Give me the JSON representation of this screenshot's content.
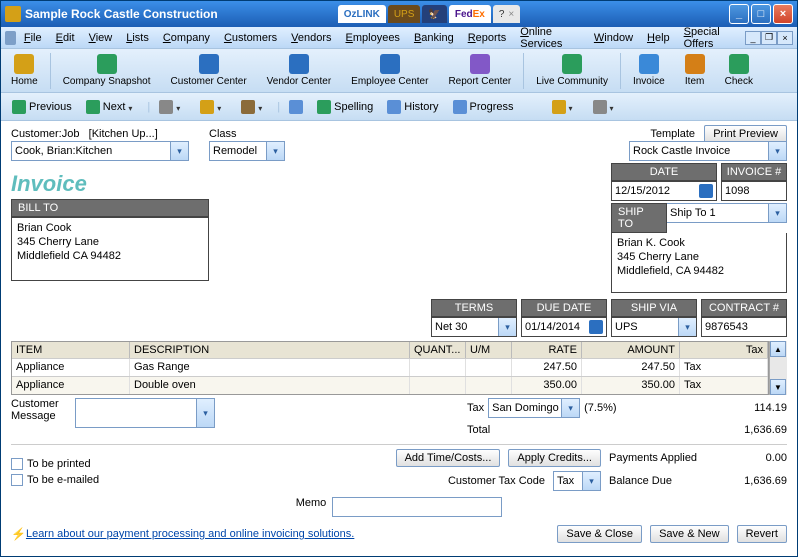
{
  "titlebar": {
    "title": "Sample Rock Castle Construction",
    "tabs": [
      "OzLINK",
      "UPS",
      "USPS",
      "FedEx",
      "?"
    ]
  },
  "menubar": [
    "File",
    "Edit",
    "View",
    "Lists",
    "Company",
    "Customers",
    "Vendors",
    "Employees",
    "Banking",
    "Reports",
    "Online Services",
    "Window",
    "Help",
    "Special Offers"
  ],
  "toolbar": [
    {
      "label": "Home",
      "color": "#d4a017"
    },
    {
      "label": "Company Snapshot",
      "color": "#2b9d5c"
    },
    {
      "label": "Customer Center",
      "color": "#2b6fc0"
    },
    {
      "label": "Vendor Center",
      "color": "#2b6fc0"
    },
    {
      "label": "Employee Center",
      "color": "#2b6fc0"
    },
    {
      "label": "Report Center",
      "color": "#8258c7"
    },
    {
      "label": "Live Community",
      "color": "#2b9d5c"
    },
    {
      "label": "Invoice",
      "color": "#3a89d8"
    },
    {
      "label": "Item",
      "color": "#d47f17"
    },
    {
      "label": "Check",
      "color": "#2b9d5c"
    }
  ],
  "navbar": {
    "prev": "Previous",
    "next": "Next",
    "spelling": "Spelling",
    "history": "History",
    "progress": "Progress"
  },
  "form": {
    "customer_label": "Customer:Job",
    "kitchen_hint": "[Kitchen Up...]",
    "customer_value": "Cook, Brian:Kitchen",
    "class_label": "Class",
    "class_value": "Remodel",
    "template_label": "Template",
    "print_preview": "Print Preview",
    "template_value": "Rock Castle Invoice",
    "invoice_title": "Invoice",
    "billto_label": "BILL TO",
    "billto_lines": [
      "Brian Cook",
      "345 Cherry Lane",
      "Middlefield CA 94482"
    ],
    "date_label": "DATE",
    "date_value": "12/15/2012",
    "invnum_label": "INVOICE #",
    "invnum_value": "1098",
    "shipto_label": "SHIP TO",
    "shipto_value": "Ship To 1",
    "shipto_lines": [
      "Brian K. Cook",
      "345 Cherry Lane",
      "Middlefield, CA 94482"
    ],
    "terms_label": "TERMS",
    "terms_value": "Net 30",
    "duedate_label": "DUE DATE",
    "duedate_value": "01/14/2014",
    "shipvia_label": "SHIP VIA",
    "shipvia_value": "UPS",
    "contract_label": "CONTRACT #",
    "contract_value": "9876543"
  },
  "cols": {
    "item": "ITEM",
    "desc": "DESCRIPTION",
    "quant": "QUANT...",
    "um": "U/M",
    "rate": "RATE",
    "amount": "AMOUNT",
    "tax": "Tax"
  },
  "lines": [
    {
      "item": "Appliance",
      "desc": "Gas Range",
      "quant": "",
      "um": "",
      "rate": "247.50",
      "amount": "247.50",
      "tax": "Tax"
    },
    {
      "item": "Appliance",
      "desc": "Double oven",
      "quant": "",
      "um": "",
      "rate": "350.00",
      "amount": "350.00",
      "tax": "Tax"
    }
  ],
  "footer": {
    "cust_msg_label": "Customer\nMessage",
    "tax_label": "Tax",
    "tax_item": "San Domingo",
    "tax_rate": "(7.5%)",
    "tax_amount": "114.19",
    "total_label": "Total",
    "total_amount": "1,636.69",
    "tobeprinted": "To be printed",
    "tobeemailed": "To be e-mailed",
    "addtime": "Add Time/Costs...",
    "applycredits": "Apply Credits...",
    "payments_label": "Payments Applied",
    "payments_amount": "0.00",
    "custtax_label": "Customer Tax Code",
    "custtax_value": "Tax",
    "balance_label": "Balance Due",
    "balance_amount": "1,636.69",
    "memo_label": "Memo",
    "learn_link": "Learn about our payment processing and online invoicing solutions.",
    "saveclose": "Save & Close",
    "savenew": "Save & New",
    "revert": "Revert"
  }
}
